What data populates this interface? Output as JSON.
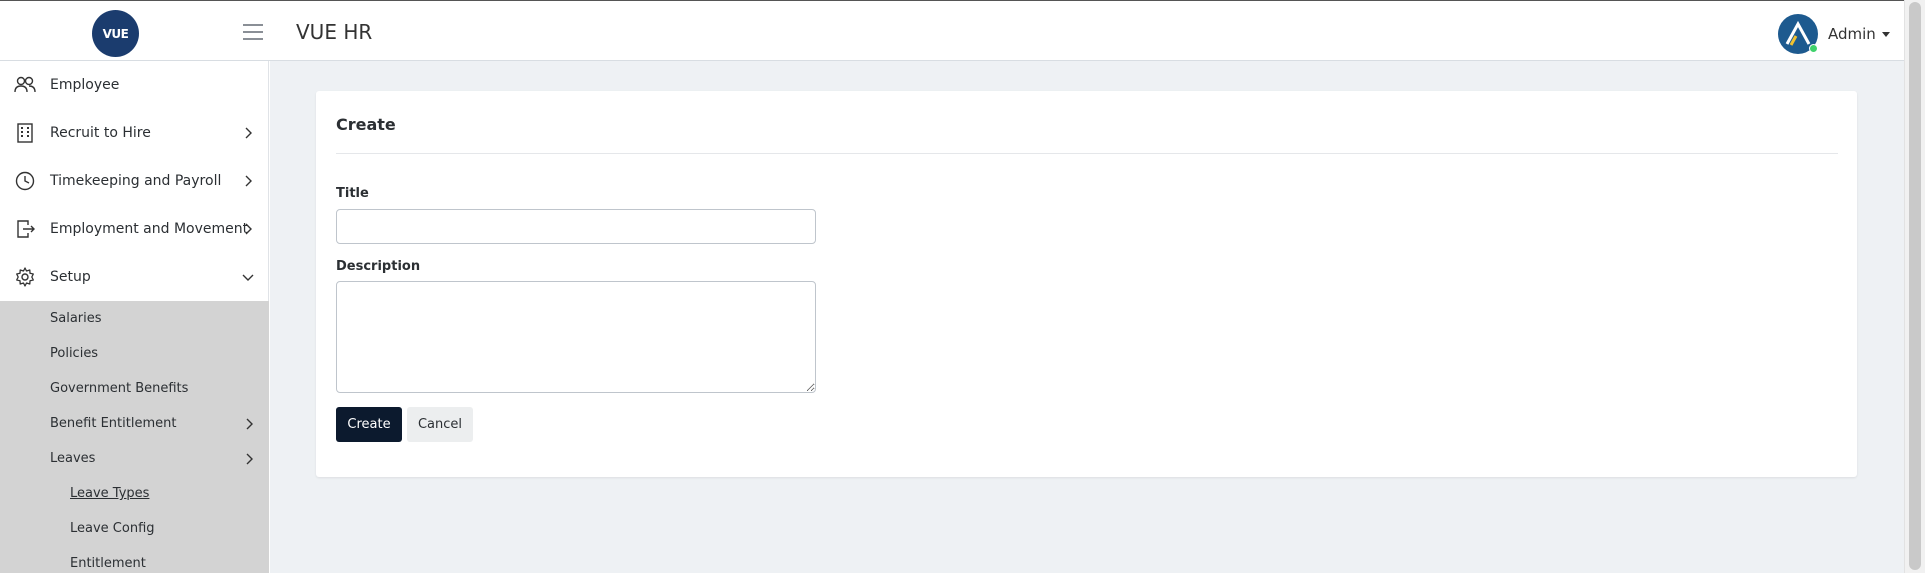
{
  "header": {
    "logo_text": "VUE",
    "app_title": "VUE HR",
    "user_name": "Admin",
    "menu_icon": "hamburger-icon",
    "avatar_icon": "user-avatar-logo"
  },
  "sidebar": {
    "items": [
      {
        "label": "Employee",
        "icon": "users-icon",
        "expandable": false
      },
      {
        "label": "Recruit to Hire",
        "icon": "building-icon",
        "expandable": true
      },
      {
        "label": "Timekeeping and Payroll",
        "icon": "clock-icon",
        "expandable": true
      },
      {
        "label": "Employment and Movement",
        "icon": "exit-door-icon",
        "expandable": true
      },
      {
        "label": "Setup",
        "icon": "gear-icon",
        "expandable": true,
        "expanded": true
      }
    ],
    "setup_children": [
      {
        "label": "Salaries"
      },
      {
        "label": "Policies"
      },
      {
        "label": "Government Benefits"
      },
      {
        "label": "Benefit Entitlement",
        "expandable": true
      },
      {
        "label": "Leaves",
        "expandable": true
      }
    ],
    "leaves_children": [
      {
        "label": "Leave Types",
        "active": true
      },
      {
        "label": "Leave Config"
      },
      {
        "label": "Entitlement"
      }
    ]
  },
  "form": {
    "heading": "Create",
    "title_label": "Title",
    "title_value": "",
    "description_label": "Description",
    "description_value": "",
    "create_button": "Create",
    "cancel_button": "Cancel"
  },
  "colors": {
    "brand_dark": "#0c1a2e",
    "logo_bg": "#1b3c6e",
    "main_bg": "#eef1f4",
    "submenu_bg": "#d3d3d3",
    "online": "#3fd16b"
  }
}
